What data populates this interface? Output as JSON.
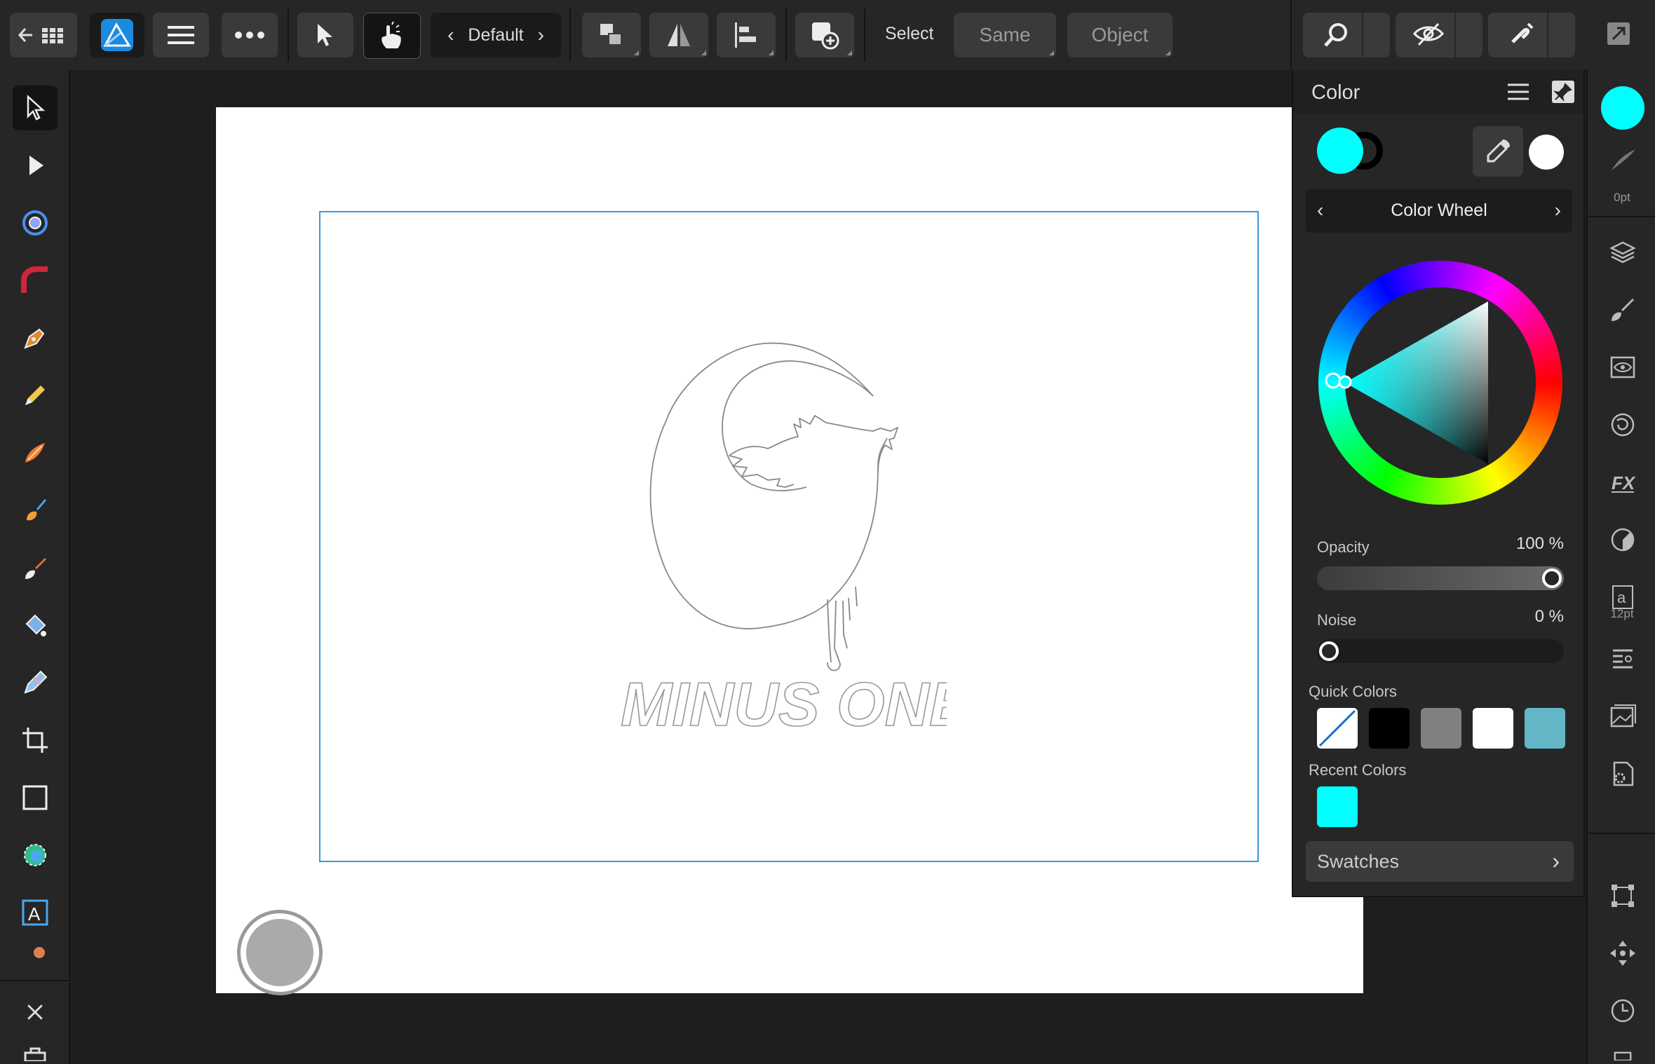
{
  "toolbar": {
    "persona_label": "Default",
    "select_label": "Select",
    "same_label": "Same",
    "object_label": "Object"
  },
  "color_panel": {
    "title": "Color",
    "mode_label": "Color Wheel",
    "primary_color": "#00FFFF",
    "stroke_color": "#000000",
    "opacity_label": "Opacity",
    "opacity_value": "100 %",
    "opacity_fraction": 1.0,
    "noise_label": "Noise",
    "noise_value": "0 %",
    "noise_fraction": 0.0,
    "quick_colors_label": "Quick Colors",
    "quick_colors": [
      "none",
      "#000000",
      "#808080",
      "#FFFFFF",
      "#62B6C5"
    ],
    "recent_colors_label": "Recent Colors",
    "recent_colors": [
      "#00FFFF"
    ],
    "swatches_label": "Swatches"
  },
  "right_bar": {
    "stroke_width": "0pt",
    "text_size": "12pt"
  },
  "canvas": {
    "artwork_text": "MINUS ONE"
  }
}
